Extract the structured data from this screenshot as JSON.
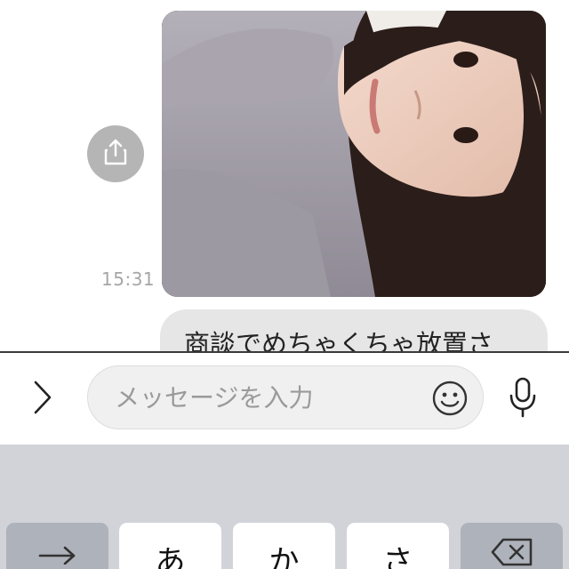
{
  "chat": {
    "timestamp": "15:31",
    "message_text": "商談でめちゃくちゃ放置さ"
  },
  "input_bar": {
    "placeholder": "メッセージを入力"
  },
  "keyboard": {
    "keys": [
      "あ",
      "か",
      "さ"
    ]
  },
  "icons": {
    "share": "share-icon",
    "expand": "chevron-right-icon",
    "emoji": "smiley-icon",
    "mic": "microphone-icon",
    "next": "arrow-right-icon",
    "delete": "backspace-icon"
  },
  "colors": {
    "bubble_gray": "#e6e6e6",
    "share_button": "#b5b5b5",
    "keyboard_bg": "#d1d3d9"
  }
}
